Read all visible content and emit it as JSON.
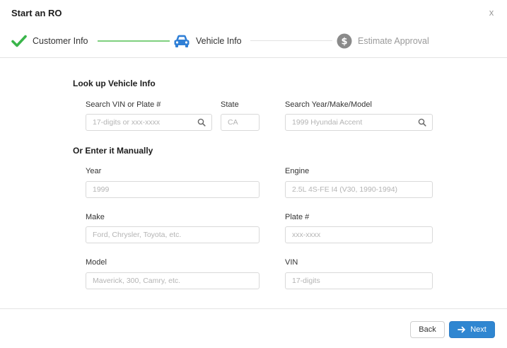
{
  "modal": {
    "title": "Start an RO",
    "close_label": "x"
  },
  "stepper": {
    "steps": [
      {
        "label": "Customer Info",
        "state": "complete"
      },
      {
        "label": "Vehicle Info",
        "state": "active"
      },
      {
        "label": "Estimate Approval",
        "state": "pending"
      }
    ]
  },
  "lookup": {
    "title": "Look up Vehicle Info",
    "vin_plate": {
      "label": "Search VIN or Plate #",
      "placeholder": "17-digits or xxx-xxxx"
    },
    "state": {
      "label": "State",
      "placeholder": "CA"
    },
    "ymm": {
      "label": "Search Year/Make/Model",
      "placeholder": "1999 Hyundai Accent"
    }
  },
  "manual": {
    "title": "Or Enter it Manually",
    "year": {
      "label": "Year",
      "placeholder": "1999"
    },
    "engine": {
      "label": "Engine",
      "placeholder": "2.5L 4S-FE I4 (V30, 1990-1994)"
    },
    "make": {
      "label": "Make",
      "placeholder": "Ford, Chrysler, Toyota, etc."
    },
    "plate": {
      "label": "Plate #",
      "placeholder": "xxx-xxxx"
    },
    "model": {
      "label": "Model",
      "placeholder": "Maverick, 300, Camry, etc."
    },
    "vin": {
      "label": "VIN",
      "placeholder": "17-digits"
    }
  },
  "footer": {
    "back_label": "Back",
    "next_label": "Next"
  },
  "colors": {
    "primary": "#2f86d1",
    "success": "#3ab54a",
    "active_step": "#2f7fd6",
    "pending_step": "#8a8a8a"
  },
  "icons": {
    "step_complete": "check-icon",
    "step_active": "car-icon",
    "step_pending": "dollar-icon",
    "search": "search-icon",
    "next": "arrow-right-icon",
    "close": "close-icon"
  }
}
